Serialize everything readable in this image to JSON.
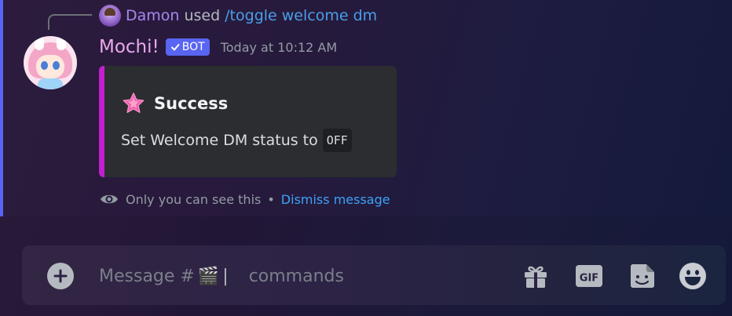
{
  "reply": {
    "username": "Damon",
    "used_text": "used",
    "command": "/toggle welcome dm"
  },
  "message": {
    "author": "Mochi!",
    "bot_tag": "BOT",
    "timestamp": "Today at 10:12 AM",
    "embed": {
      "accent_color": "#c21fd0",
      "title": "Success",
      "description": "Set Welcome DM status to",
      "code_value": "OFF",
      "icon": "pink-star-icon"
    },
    "ephemeral": {
      "note": "Only you can see this",
      "separator": "•",
      "dismiss_label": "Dismiss message"
    }
  },
  "composer": {
    "placeholder_start": "Message #",
    "channel_emoji": "🎬",
    "cursor": "|",
    "placeholder_end": "commands",
    "icons": [
      "add-icon",
      "gift-icon",
      "gif-icon",
      "sticker-icon",
      "emoji-icon"
    ]
  },
  "colors": {
    "brand": "#5865f2",
    "author": "#e9a8ec",
    "link": "#3ea2f5"
  }
}
